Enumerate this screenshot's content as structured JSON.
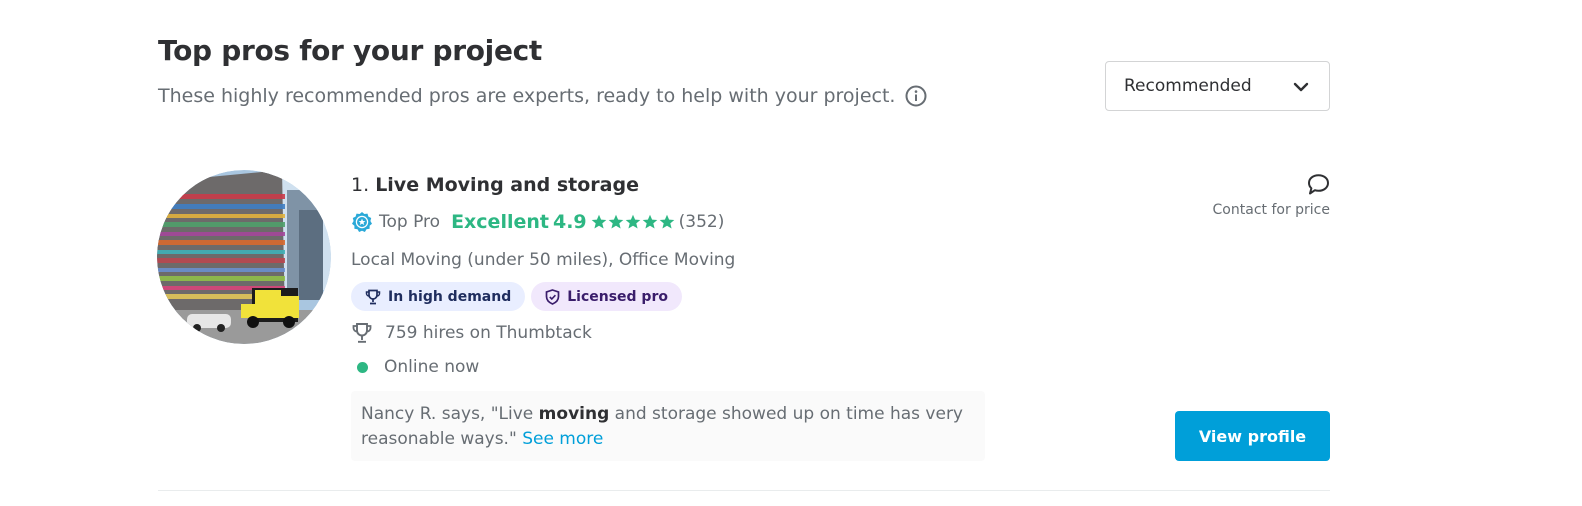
{
  "header": {
    "title": "Top pros for your project",
    "subtitle": "These highly recommended pros are experts, ready to help with your project."
  },
  "sort": {
    "selected": "Recommended"
  },
  "pro": {
    "rank": "1.",
    "name": "Live Moving and storage",
    "top_pro_label": "Top Pro",
    "rating_label": "Excellent",
    "rating_value": "4.9",
    "stars": 5,
    "review_count": "(352)",
    "services": "Local Moving (under 50 miles), Office Moving",
    "badges": {
      "demand": "In high demand",
      "licensed": "Licensed pro"
    },
    "hires": "759 hires on Thumbtack",
    "online": "Online now",
    "review": {
      "prefix": "Nancy R. says, \"Live ",
      "highlight": "moving",
      "suffix": " and storage showed up on time has very reasonable ways.\"",
      "see_more": "See more"
    },
    "contact_label": "Contact for price",
    "view_profile": "View profile"
  },
  "colors": {
    "accent": "#009fd9",
    "rating": "#2db783",
    "text": "#2f3033",
    "muted": "#676d73"
  },
  "icons": [
    "info-icon",
    "chevron-down-icon",
    "top-pro-icon",
    "star-icon",
    "trophy-icon",
    "shield-icon",
    "chat-bubble-icon"
  ]
}
